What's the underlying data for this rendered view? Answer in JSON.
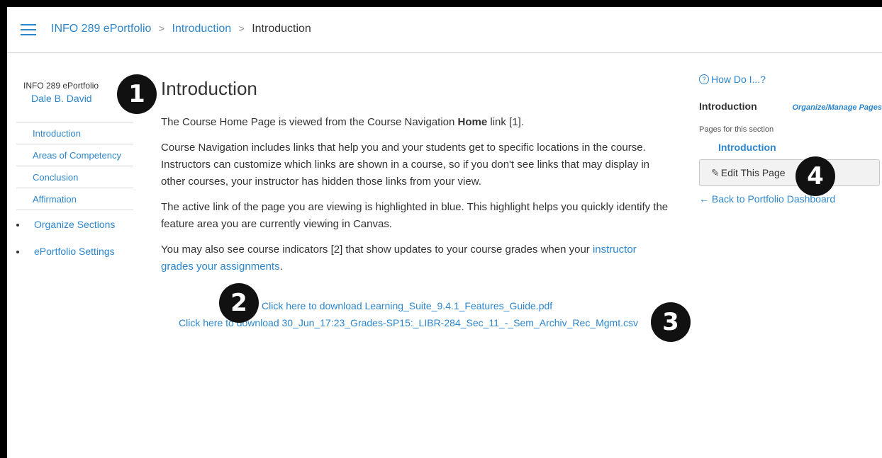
{
  "header": {
    "menu_icon": "hamburger-icon",
    "breadcrumbs": [
      "INFO 289 ePortfolio",
      "Introduction",
      "Introduction"
    ],
    "separator": ">"
  },
  "sidebar": {
    "title": "INFO 289 ePortfolio",
    "user": "Dale B. David",
    "items": [
      "Introduction",
      "Areas of Competency",
      "Conclusion",
      "Affirmation"
    ],
    "actions": [
      "Organize Sections",
      "ePortfolio Settings"
    ]
  },
  "main": {
    "title": "Introduction",
    "p1_before": "The Course Home Page is viewed from the Course Navigation ",
    "p1_bold": "Home",
    "p1_after": " link [1].",
    "p2": "Course Navigation includes links that help you and your students get to specific locations in the course. Instructors can customize which links are shown in a course, so if you don't see links that may display in other courses, your instructor has hidden those links from your view.",
    "p3": "The active link of the page you are viewing is highlighted in blue. This highlight helps you quickly identify the feature area you are currently viewing in Canvas.",
    "p4_before": "You may also see course indicators [2] that show updates to your course grades when your ",
    "p4_link": "instructor grades your assignments",
    "p4_after": ".",
    "download1": "Click here to download Learning_Suite_9.4.1_Features_Guide.pdf",
    "download2": "Click here to download 30_Jun_17:23_Grades-SP15:_LIBR-284_Sec_11_-_Sem_Archiv_Rec_Mgmt.csv"
  },
  "right": {
    "help_icon": "question-circle-icon",
    "help": "How Do I...?",
    "page_title": "Introduction",
    "organize": "Organize/Manage Pages",
    "pages_label": "Pages for this section",
    "page_link": "Introduction",
    "edit_icon": "pencil-icon",
    "edit": "Edit This Page",
    "back": "← Back to Portfolio Dashboard"
  },
  "badges": [
    "1",
    "2",
    "3",
    "4"
  ],
  "colors": {
    "link": "#2d86cc",
    "text": "#333333",
    "badge": "#111111"
  }
}
